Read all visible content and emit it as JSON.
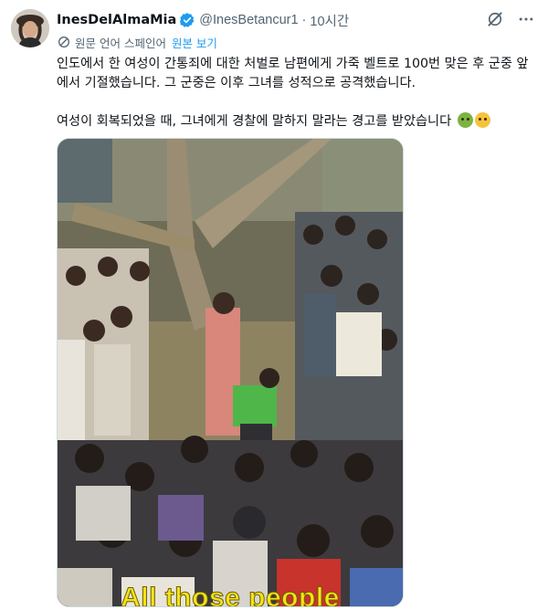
{
  "author": {
    "display_name": "InesDelAlmaMia",
    "handle": "@InesBetancur1",
    "time": "10시간",
    "separator": "·"
  },
  "translation": {
    "label": "원문 언어 스페인어",
    "show_original": "원본 보기"
  },
  "tweet": {
    "paragraph1": "인도에서 한 여성이 간통죄에 대한 처벌로 남편에게 가죽 벨트로 100번 맞은 후 군중 앞에서 기절했습니다. 그 군중은 이후 그녀를 성적으로 공격했습니다.",
    "paragraph2": "여성이 회복되었을 때, 그녀에게 경찰에 말하지 말라는 경고를 받았습니다",
    "emojis": [
      "nauseated-face",
      "face-vomiting"
    ]
  },
  "media": {
    "caption": "All those people",
    "caption_color": "#f5e31a"
  },
  "colors": {
    "link": "#1d9bf0",
    "verified": "#1d9bf0",
    "secondary_text": "#536471"
  },
  "icons": {
    "verified": "verified-badge-icon",
    "grok": "grok-icon",
    "more": "more-icon",
    "translate": "translate-icon"
  }
}
